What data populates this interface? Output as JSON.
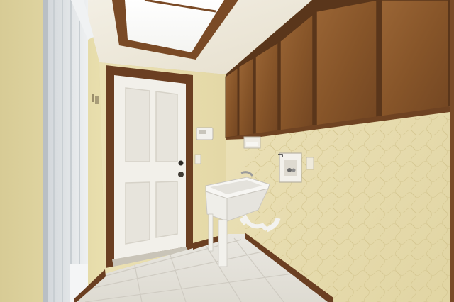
{
  "scene": {
    "kind": "photograph",
    "subject": "laundry room",
    "colors": {
      "wall": "#e6dcad",
      "wall_right": "#e8ddb2",
      "ceiling": "#eee9dd",
      "cabinet": "#8b5a2e",
      "cabinet_dark": "#6f4322",
      "trim": "#6b3f22",
      "door": "#f2f0ea",
      "tile": "#e8e6df",
      "tile_grout": "#cfcbc2",
      "sink": "#f1f0ec",
      "blinds": "#dfe3e6"
    }
  }
}
